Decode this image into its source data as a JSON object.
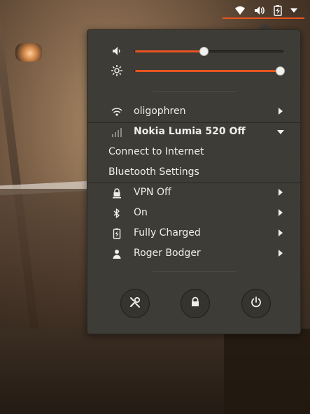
{
  "top_panel": {
    "indicators": [
      "wifi-icon",
      "volume-icon",
      "battery-icon",
      "chevron-down-icon"
    ]
  },
  "sliders": {
    "volume": {
      "icon": "volume-icon",
      "level": 0.46
    },
    "brightness": {
      "icon": "brightness-icon",
      "level": 1.0
    }
  },
  "network": {
    "wifi": {
      "label": "oligophren",
      "icon": "wifi-icon"
    },
    "mobile": {
      "label": "Nokia Lumia 520 Off",
      "icon": "signal-icon",
      "submenu": [
        "Connect to Internet",
        "Bluetooth Settings"
      ]
    }
  },
  "items": [
    {
      "label": "VPN Off",
      "icon": "vpn-lock-icon"
    },
    {
      "label": "On",
      "icon": "bluetooth-icon"
    },
    {
      "label": "Fully Charged",
      "icon": "battery-icon"
    },
    {
      "label": "Roger Bodger",
      "icon": "user-icon"
    }
  ],
  "actions": [
    "settings-icon",
    "lock-icon",
    "power-icon"
  ],
  "colors": {
    "accent": "#e95420",
    "menu_bg": "#3d3c37"
  }
}
